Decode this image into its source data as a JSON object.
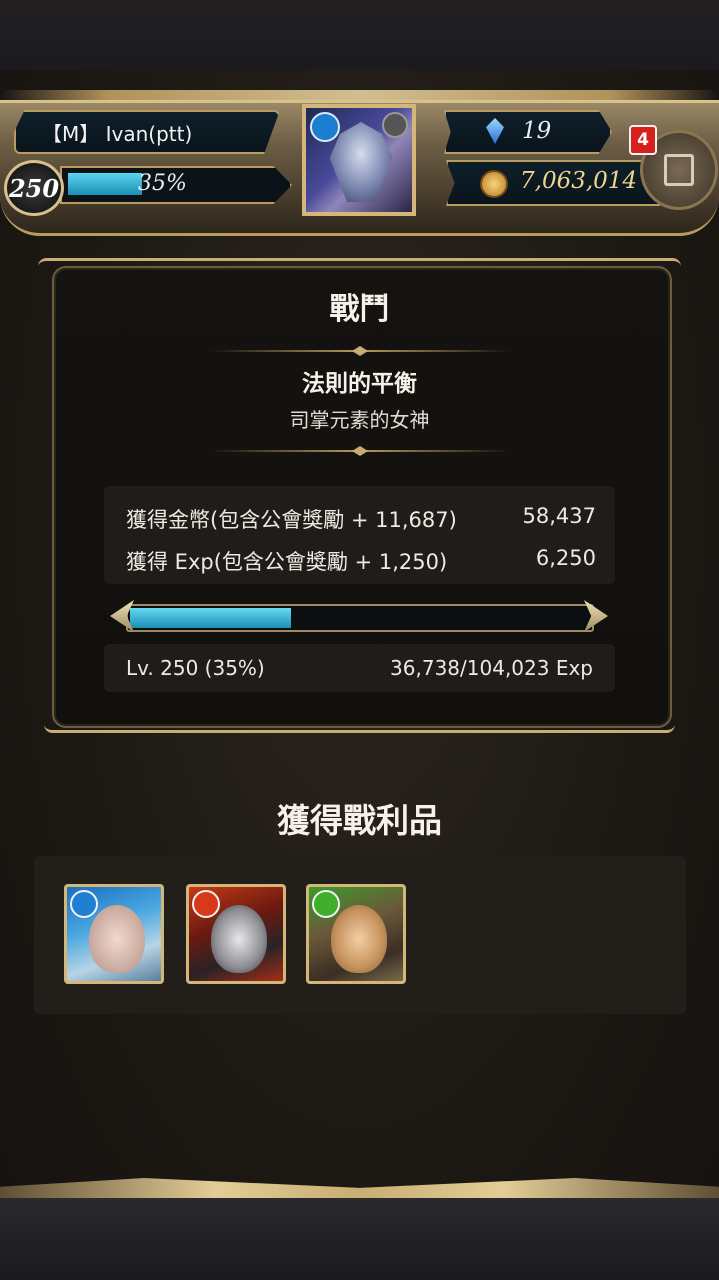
{
  "header": {
    "player_name": "【M】 Ivan(ptt)",
    "level": "250",
    "exp_percent_label": "35%",
    "exp_fraction": 0.35,
    "gems": "19",
    "coins": "7,063,014",
    "notification_count": "4"
  },
  "battle": {
    "title": "戰鬥",
    "stage_name": "法則的平衡",
    "stage_subtitle": "司掌元素的女神",
    "rewards": [
      {
        "label": "獲得金幣(包含公會獎勵 + 11,687)",
        "value": "58,437"
      },
      {
        "label": "獲得 Exp(包含公會獎勵 + 1,250)",
        "value": "6,250"
      }
    ],
    "progress_fraction": 0.35,
    "level_text": "Lv. 250 (35%)",
    "exp_text": "36,738/104,023 Exp"
  },
  "loot": {
    "title": "獲得戰利品",
    "items": [
      {
        "name": "water-card",
        "element": "water"
      },
      {
        "name": "fire-card",
        "element": "fire"
      },
      {
        "name": "wood-card",
        "element": "wood"
      }
    ]
  },
  "colors": {
    "accent_gold": "#c9ad72",
    "exp_bar": "#1a90b4",
    "notification": "#d6201c"
  }
}
